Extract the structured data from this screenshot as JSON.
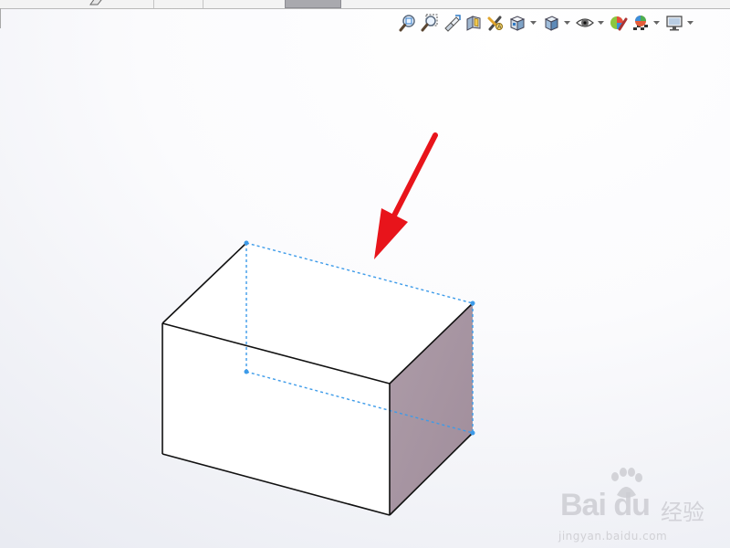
{
  "toolbar": {
    "tools": [
      {
        "name": "zoom-to-fit-icon",
        "dropdown": false
      },
      {
        "name": "zoom-to-area-icon",
        "dropdown": false
      },
      {
        "name": "previous-view-icon",
        "dropdown": false
      },
      {
        "name": "section-view-icon",
        "dropdown": false
      },
      {
        "name": "dynamic-annotation-views-icon",
        "dropdown": false
      },
      {
        "name": "view-orientation-icon",
        "dropdown": true
      },
      {
        "name": "display-style-icon",
        "dropdown": true
      },
      {
        "name": "hide-show-items-icon",
        "dropdown": true
      },
      {
        "name": "edit-appearance-icon",
        "dropdown": false
      },
      {
        "name": "apply-scene-icon",
        "dropdown": true
      },
      {
        "name": "view-settings-icon",
        "dropdown": true
      }
    ]
  },
  "model": {
    "shape": "rectangular-block",
    "side_face_color": "#a796a2",
    "top_face_color": "#ffffff",
    "front_face_color": "#ffffff",
    "edge_color": "#111111",
    "hidden_edge_color": "#3d9be9"
  },
  "annotation": {
    "arrow_color": "#e8141b"
  },
  "watermark": {
    "brand": "Bai du",
    "cn": "经验",
    "domain": "jingyan.baidu.com"
  }
}
